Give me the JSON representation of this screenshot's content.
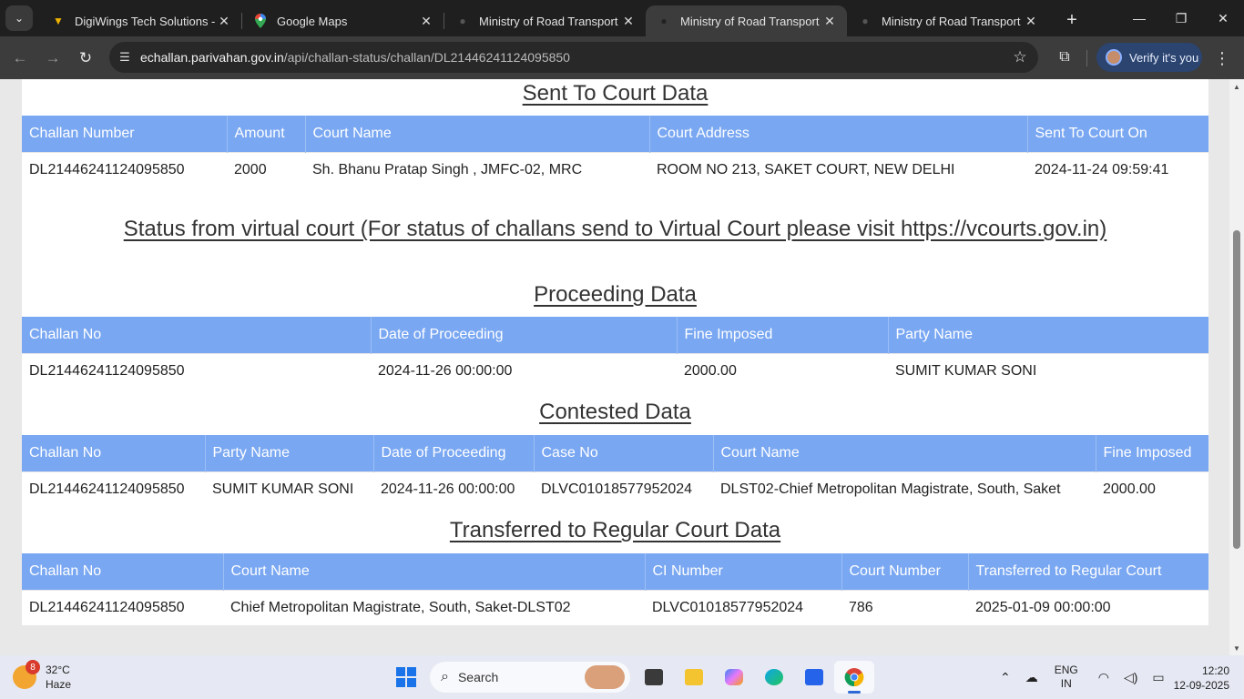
{
  "browser": {
    "tabs": [
      {
        "title": "DigiWings Tech Solutions -",
        "favicon": "wings-icon",
        "active": false
      },
      {
        "title": "Google Maps",
        "favicon": "maps-pin-icon",
        "active": false
      },
      {
        "title": "Ministry of Road Transport a",
        "favicon": "globe-icon",
        "active": false
      },
      {
        "title": "Ministry of Road Transport a",
        "favicon": "globe-icon",
        "active": true
      },
      {
        "title": "Ministry of Road Transport a",
        "favicon": "globe-icon",
        "active": false
      }
    ],
    "url_host": "echallan.parivahan.gov.in",
    "url_path": "/api/challan-status/challan/DL21446241124095850",
    "profile_label": "Verify it's you"
  },
  "page": {
    "sent_to_court": {
      "heading": "Sent To Court Data",
      "headers": [
        "Challan Number",
        "Amount",
        "Court Name",
        "Court Address",
        "Sent To Court On"
      ],
      "rows": [
        [
          "DL21446241124095850",
          "2000",
          "Sh. Bhanu Pratap Singh , JMFC-02, MRC",
          "ROOM NO 213, SAKET COURT, NEW DELHI",
          "2024-11-24 09:59:41"
        ]
      ]
    },
    "virtual_court": {
      "heading": "Status from virtual court (For status of challans send to Virtual Court please visit https://vcourts.gov.in)"
    },
    "proceeding": {
      "heading": "Proceeding Data",
      "headers": [
        "Challan No",
        "Date of Proceeding",
        "Fine Imposed",
        "Party Name"
      ],
      "rows": [
        [
          "DL21446241124095850",
          "2024-11-26 00:00:00",
          "2000.00",
          "SUMIT KUMAR SONI"
        ]
      ]
    },
    "contested": {
      "heading": "Contested Data",
      "headers": [
        "Challan No",
        "Party Name",
        "Date of Proceeding",
        "Case No",
        "Court Name",
        "Fine Imposed"
      ],
      "rows": [
        [
          "DL21446241124095850",
          "SUMIT KUMAR SONI",
          "2024-11-26 00:00:00",
          "DLVC01018577952024",
          "DLST02-Chief Metropolitan Magistrate, South, Saket",
          "2000.00"
        ]
      ]
    },
    "transferred": {
      "heading": "Transferred to Regular Court Data",
      "headers": [
        "Challan No",
        "Court Name",
        "CI Number",
        "Court Number",
        "Transferred to Regular Court"
      ],
      "rows": [
        [
          "DL21446241124095850",
          "Chief Metropolitan Magistrate, South, Saket-DLST02",
          "DLVC01018577952024",
          "786",
          "2025-01-09 00:00:00"
        ]
      ]
    }
  },
  "taskbar": {
    "weather_temp": "32°C",
    "weather_desc": "Haze",
    "weather_badge": "8",
    "search_label": "Search",
    "lang_line1": "ENG",
    "lang_line2": "IN",
    "time": "12:20",
    "date": "12-09-2025"
  }
}
